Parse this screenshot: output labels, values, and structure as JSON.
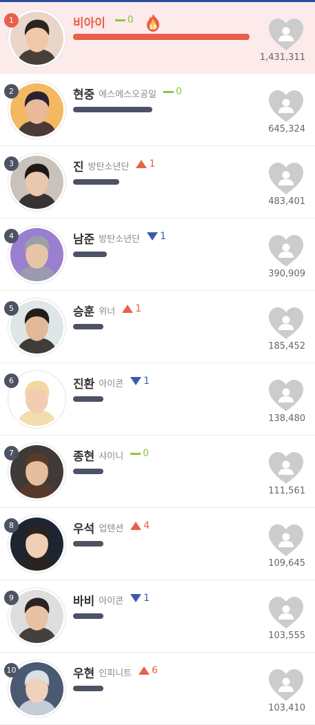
{
  "colors": {
    "accent": "#e8604c",
    "rank_badge": "#4d5264",
    "same": "#8cc63f",
    "up": "#e8604c",
    "down": "#3a5bb0",
    "heart": "#cccccc",
    "first_row_bg": "#fdeaea"
  },
  "icons": {
    "heart": "heart-vote-icon",
    "fire_badge": "fire-10-icon",
    "up": "triangle-up-icon",
    "down": "triangle-down-icon",
    "same": "dash-icon"
  },
  "ranking": [
    {
      "rank": "1",
      "name": "비아이",
      "group": "",
      "change_dir": "same",
      "change": "0",
      "votes": "1,431,311",
      "vote_share": 1.0,
      "fire_badge": "10"
    },
    {
      "rank": "2",
      "name": "현중",
      "group": "에스에스오공일",
      "change_dir": "same",
      "change": "0",
      "votes": "645,324",
      "vote_share": 0.45
    },
    {
      "rank": "3",
      "name": "진",
      "group": "방탄소년단",
      "change_dir": "up",
      "change": "1",
      "votes": "483,401",
      "vote_share": 0.26
    },
    {
      "rank": "4",
      "name": "남준",
      "group": "방탄소년단",
      "change_dir": "down",
      "change": "1",
      "votes": "390,909",
      "vote_share": 0.19
    },
    {
      "rank": "5",
      "name": "승훈",
      "group": "위너",
      "change_dir": "up",
      "change": "1",
      "votes": "185,452",
      "vote_share": 0.17
    },
    {
      "rank": "6",
      "name": "진환",
      "group": "아이콘",
      "change_dir": "down",
      "change": "1",
      "votes": "138,480",
      "vote_share": 0.17
    },
    {
      "rank": "7",
      "name": "종현",
      "group": "샤이니",
      "change_dir": "same",
      "change": "0",
      "votes": "111,561",
      "vote_share": 0.17
    },
    {
      "rank": "8",
      "name": "우석",
      "group": "업텐션",
      "change_dir": "up",
      "change": "4",
      "votes": "109,645",
      "vote_share": 0.17
    },
    {
      "rank": "9",
      "name": "바비",
      "group": "아이콘",
      "change_dir": "down",
      "change": "1",
      "votes": "103,555",
      "vote_share": 0.17
    },
    {
      "rank": "10",
      "name": "우현",
      "group": "인피니트",
      "change_dir": "up",
      "change": "6",
      "votes": "103,410",
      "vote_share": 0.17
    }
  ]
}
